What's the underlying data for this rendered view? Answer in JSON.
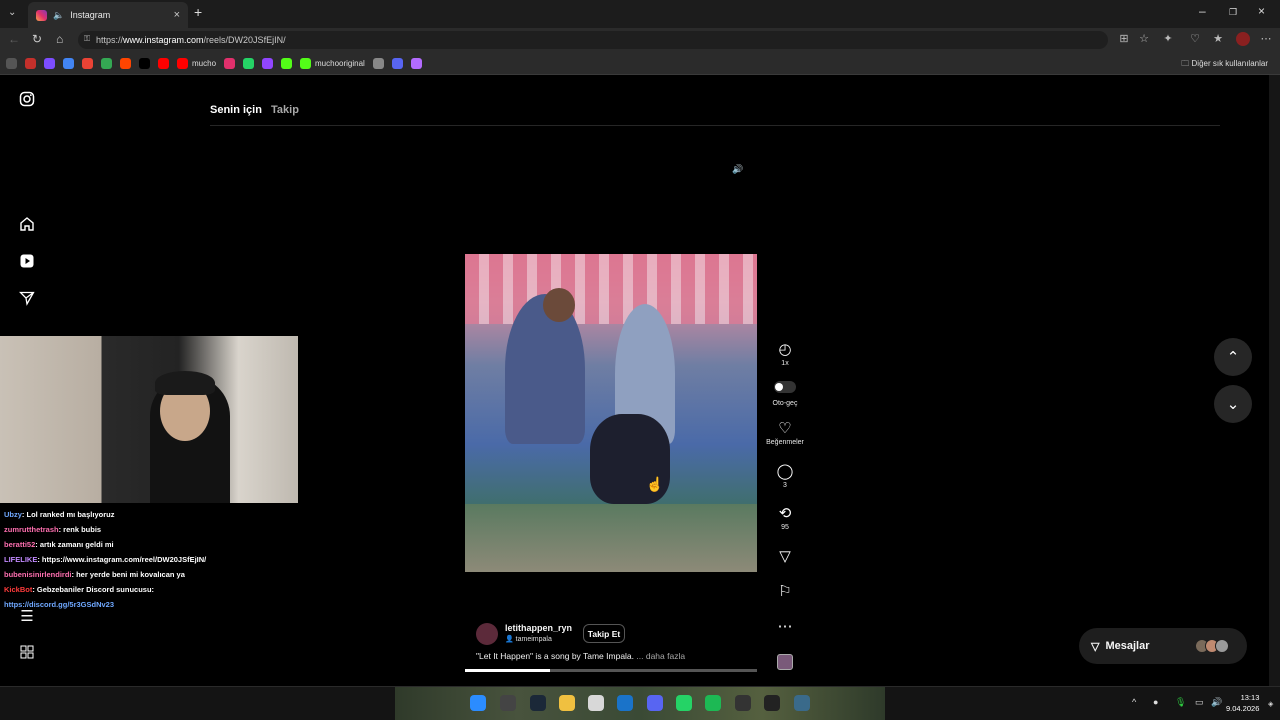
{
  "browser": {
    "tab_title": "Instagram",
    "new_tab": "+",
    "url_prefix": "https://",
    "url_domain": "www.instagram.com",
    "url_path": "/reels/DW20JSfEjIN/",
    "bookmarks": [
      {
        "label": "",
        "color": "#555555"
      },
      {
        "label": "",
        "color": "#c4302b"
      },
      {
        "label": "",
        "color": "#7c4dff"
      },
      {
        "label": "",
        "color": "#4285f4"
      },
      {
        "label": "",
        "color": "#ea4335"
      },
      {
        "label": "",
        "color": "#34a853"
      },
      {
        "label": "",
        "color": "#ff4500"
      },
      {
        "label": "",
        "color": "#000000"
      },
      {
        "label": "",
        "color": "#ff0000"
      },
      {
        "label": "mucho",
        "color": "#ff0000"
      },
      {
        "label": "",
        "color": "#e1306c"
      },
      {
        "label": "",
        "color": "#25d366"
      },
      {
        "label": "",
        "color": "#9146ff"
      },
      {
        "label": "",
        "color": "#53fc18"
      },
      {
        "label": "muchooriginal",
        "color": "#53fc18"
      },
      {
        "label": "",
        "color": "#888888"
      },
      {
        "label": "",
        "color": "#5865f2"
      },
      {
        "label": "",
        "color": "#b36bff"
      }
    ],
    "other_bookmarks": "Diğer sık kullanılanlar"
  },
  "instagram": {
    "feed_tabs": [
      "Senin için",
      "Takip"
    ],
    "reel": {
      "username": "letithappen_ryn",
      "audio": "tameimpala",
      "follow_label": "Takip Et",
      "caption": "\"Let It Happen\" is a song by Tame Impala.",
      "more_label": "... daha fazla",
      "progress": 0.29
    },
    "actions": {
      "speed": "1x",
      "autoplay": "Oto-geç",
      "likes": "Beğenmeler",
      "comments": "3",
      "reposts": "95"
    },
    "messages_label": "Mesajlar"
  },
  "stream_chat": [
    {
      "user": "Ubzy",
      "user_color": "#6fa8ff",
      "text": ": Lol ranked mı başlıyoruz"
    },
    {
      "user": "zumrutthetrash",
      "user_color": "#ff6fb0",
      "text": ": renk bubis"
    },
    {
      "user": "beratti52",
      "user_color": "#ff6fb0",
      "text": ": artık zamanı geldi mi"
    },
    {
      "user": "LIFELIKE",
      "user_color": "#c28aff",
      "text": ": https://www.instagram.com/reel/DW20JSfEjIN/"
    },
    {
      "user": "bubenisinirlendirdi",
      "user_color": "#ff6fb0",
      "text": ": her yerde beni mi kovalıcan ya"
    },
    {
      "user": "KickBot",
      "user_color": "#ff3b3b",
      "text": ": Gebzebaniler Discord sunucusu:"
    },
    {
      "user": "",
      "user_color": "#6fa8ff",
      "text": "https://discord.gg/5r3GSdNv23"
    }
  ],
  "taskbar": {
    "time": "13:13",
    "date": "9.04.2026"
  }
}
